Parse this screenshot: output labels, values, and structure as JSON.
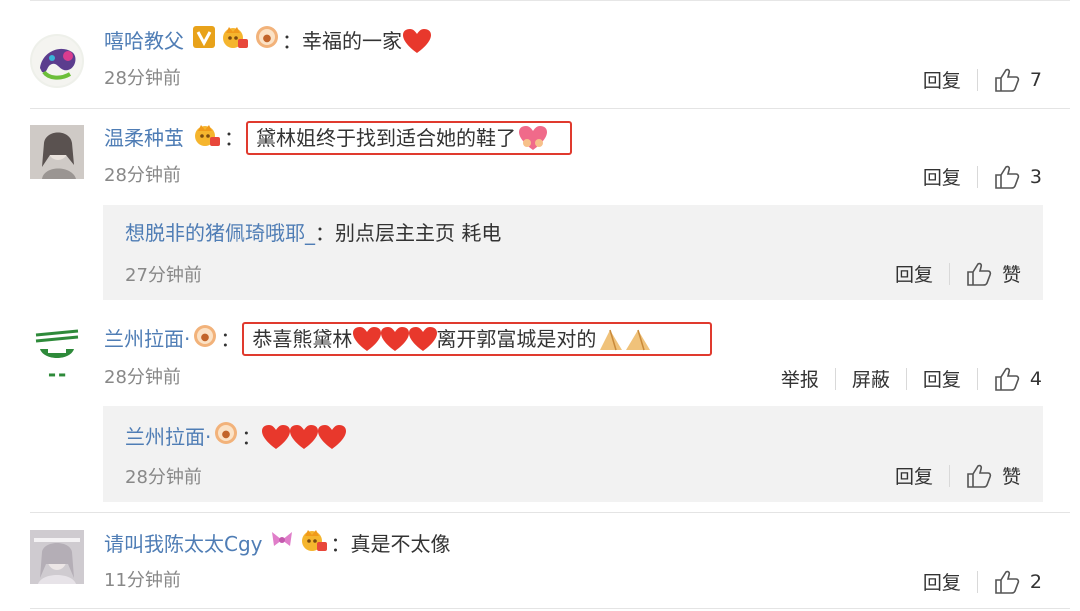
{
  "comments": [
    {
      "author": "嘻哈教父",
      "text_before": "：幸福的一家",
      "time": "28分钟前",
      "reply_label": "回复",
      "likes": "7"
    },
    {
      "author": "温柔种茧",
      "text_before": "：",
      "text": "黛林姐终于找到适合她的鞋了",
      "time": "28分钟前",
      "reply_label": "回复",
      "likes": "3",
      "replies": [
        {
          "author": "想脱非的猪佩琦哦耶_",
          "text": "：别点层主主页 耗电",
          "time": "27分钟前",
          "reply_label": "回复",
          "like_label": "赞"
        }
      ]
    },
    {
      "author": "兰州拉面·",
      "text_before": "：",
      "text_a": "恭喜熊黛林",
      "text_b": "离开郭富城是对的",
      "time": "28分钟前",
      "report_label": "举报",
      "block_label": "屏蔽",
      "reply_label": "回复",
      "likes": "4",
      "replies": [
        {
          "author": "兰州拉面·",
          "text": "：",
          "time": "28分钟前",
          "reply_label": "回复",
          "like_label": "赞"
        }
      ]
    },
    {
      "author": "请叫我陈太太Cgy",
      "text": "：真是不太像",
      "time": "11分钟前",
      "reply_label": "回复",
      "likes": "2"
    }
  ],
  "colors": {
    "name_link": "#4f7db5",
    "highlight_border": "#e03a2e",
    "heart": "#e8382c",
    "reply_bg": "#f2f2f2",
    "vip_badge": "#e8a21a"
  },
  "icons": [
    "vip-v-icon",
    "crown-badge-icon",
    "food-badge-icon",
    "heart-emoji-icon",
    "pink-heart-emoji-icon",
    "clap-emoji-icon",
    "bow-icon",
    "thumb-up-icon"
  ]
}
